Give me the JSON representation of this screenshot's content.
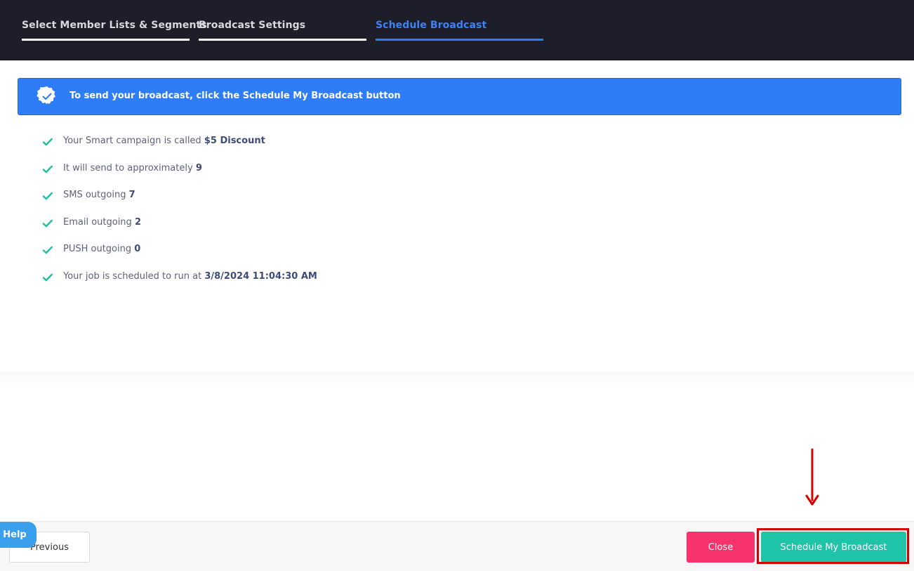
{
  "tabs": [
    {
      "label": "Select Member Lists & Segments",
      "active": false
    },
    {
      "label": "Broadcast Settings",
      "active": false
    },
    {
      "label": "Schedule Broadcast",
      "active": true
    }
  ],
  "banner": {
    "message": "To send your broadcast, click the Schedule My Broadcast button",
    "icon": "badge-check-icon"
  },
  "summary": [
    {
      "text": "Your Smart campaign is called",
      "value": "$5 Discount"
    },
    {
      "text": "It will send to approximately",
      "value": "9"
    },
    {
      "text": "SMS outgoing",
      "value": "7"
    },
    {
      "text": "Email outgoing",
      "value": "2"
    },
    {
      "text": "PUSH outgoing",
      "value": "0"
    },
    {
      "text": "Your job is scheduled to run at",
      "value": "3/8/2024 11:04:30 AM"
    }
  ],
  "footer": {
    "previous_label": "Previous",
    "close_label": "Close",
    "schedule_label": "Schedule My Broadcast"
  },
  "help": {
    "label": "Help"
  },
  "colors": {
    "topbar": "#1e1e2a",
    "accent_blue": "#2e7cf6",
    "check_teal": "#1fbfa0",
    "close_pink": "#f7336d",
    "schedule_teal": "#1fc3a8",
    "annotation_red": "#d40000",
    "help_blue": "#3aa0ee"
  }
}
